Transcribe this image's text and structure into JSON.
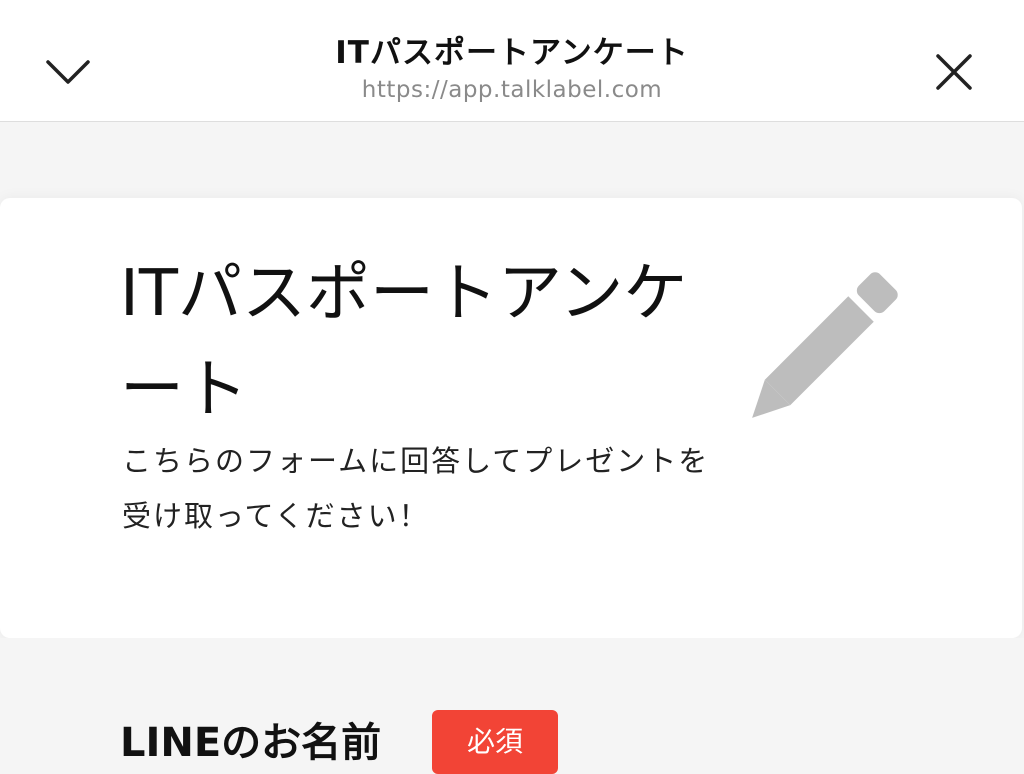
{
  "header": {
    "title": "ITパスポートアンケート",
    "url": "https://app.talklabel.com",
    "collapse_icon": "chevron-down-icon",
    "close_icon": "close-icon"
  },
  "form": {
    "title": "ITパスポートアンケート",
    "description": "こちらのフォームに回答してプレゼントを受け取ってください！",
    "header_icon": "pencil-icon"
  },
  "fields": [
    {
      "label": "LINEのお名前",
      "required_badge": "必須"
    }
  ],
  "colors": {
    "required_badge": "#f24436",
    "icon_gray": "#bdbdbd",
    "url_gray": "#8a8a8a",
    "background": "#f5f5f5"
  }
}
